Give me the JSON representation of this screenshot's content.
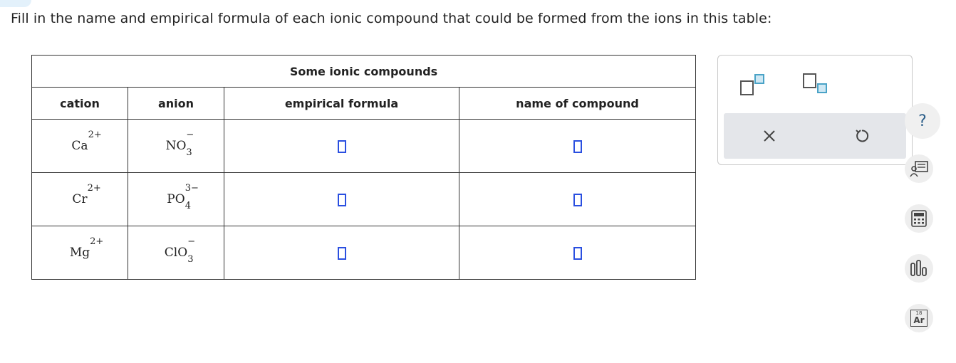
{
  "instructions": "Fill in the name and empirical formula of each ionic compound that could be formed from the ions in this table:",
  "table": {
    "caption": "Some ionic compounds",
    "headers": {
      "cation": "cation",
      "anion": "anion",
      "formula": "empirical formula",
      "name": "name of compound"
    },
    "rows": [
      {
        "cation": {
          "base": "Ca",
          "charge": "2+"
        },
        "anion": {
          "base": "NO",
          "sub": "3",
          "charge": "−"
        },
        "formula": "",
        "name": ""
      },
      {
        "cation": {
          "base": "Cr",
          "charge": "2+"
        },
        "anion": {
          "base": "PO",
          "sub": "4",
          "charge": "3−"
        },
        "formula": "",
        "name": ""
      },
      {
        "cation": {
          "base": "Mg",
          "charge": "2+"
        },
        "anion": {
          "base": "ClO",
          "sub": "3",
          "charge": "−"
        },
        "formula": "",
        "name": ""
      }
    ]
  },
  "tool_panel": {
    "icons": [
      "superscript-template-icon",
      "subscript-template-icon",
      "clear-icon",
      "undo-icon"
    ],
    "accent_color": "#4aa3c7"
  },
  "sidebar_icons": {
    "help": "?",
    "periodic_element_number": "18",
    "periodic_element_symbol": "Ar"
  },
  "colors": {
    "answer_box": "#2a4fe0",
    "panel_action_bg": "#e4e6ea"
  }
}
